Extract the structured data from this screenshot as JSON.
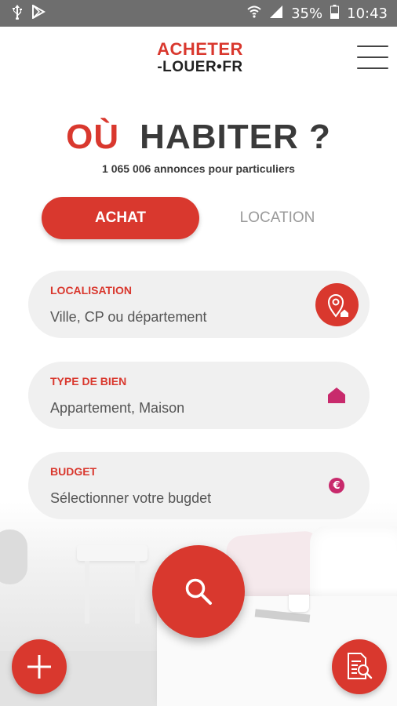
{
  "status_bar": {
    "battery": "35%",
    "time": "10:43",
    "icons": [
      "usb-icon",
      "play-store-icon",
      "wifi-icon",
      "signal-icon",
      "battery-icon"
    ]
  },
  "header": {
    "logo_line1": "ACHETER",
    "logo_line2": "-LOUER•FR"
  },
  "hero": {
    "title_accent": "OÙ",
    "title_main": "HABITER ?",
    "subtitle": "1 065 006 annonces pour particuliers"
  },
  "tabs": {
    "achat": "ACHAT",
    "location": "LOCATION",
    "selected": "achat"
  },
  "fields": {
    "localisation": {
      "label": "LOCALISATION",
      "placeholder": "Ville, CP ou département",
      "icon": "location-pin-icon"
    },
    "type_bien": {
      "label": "TYPE DE BIEN",
      "placeholder": "Appartement, Maison",
      "icon": "house-icon"
    },
    "budget": {
      "label": "BUDGET",
      "placeholder": "Sélectionner votre bugdet",
      "icon": "euro-icon",
      "icon_glyph": "€"
    }
  },
  "actions": {
    "search": "search-icon",
    "add": "plus-icon",
    "saved_searches": "document-search-icon"
  },
  "colors": {
    "accent": "#d9382e",
    "text_dark": "#3a3a3a",
    "field_bg": "#f0f0f0",
    "icon_magenta": "#c82a6c",
    "status_bar": "#6e6e6e"
  }
}
